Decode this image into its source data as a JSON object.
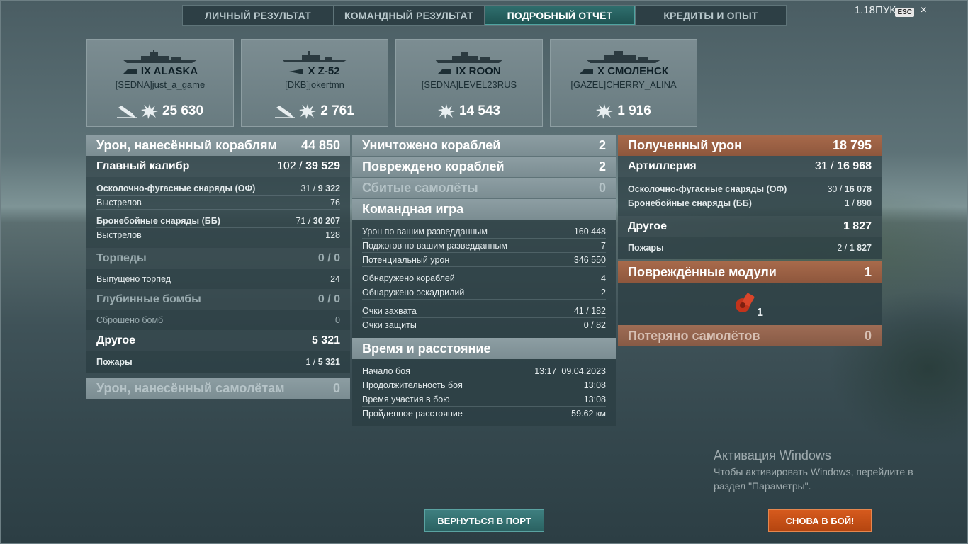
{
  "tabs": [
    "ЛИЧНЫЙ РЕЗУЛЬТАТ",
    "КОМАНДНЫЙ РЕЗУЛЬТАТ",
    "ПОДРОБНЫЙ ОТЧЁТ",
    "КРЕДИТЫ И ОПЫТ"
  ],
  "active_tab": 2,
  "top_right": {
    "label": "1.18ПУК",
    "esc": "ESC",
    "close": "×"
  },
  "ships": [
    {
      "tier": "IX",
      "name": "ALASKA",
      "player": "[SEDNA]just_a_game",
      "damage": "25 630",
      "has_sunk_icon": true
    },
    {
      "tier": "X",
      "name": "Z-52",
      "player": "[DKB]jokertmn",
      "damage": "2 761",
      "has_sunk_icon": true
    },
    {
      "tier": "IX",
      "name": "ROON",
      "player": "[SEDNA]LEVEL23RUS",
      "damage": "14 543",
      "has_sunk_icon": false
    },
    {
      "tier": "X",
      "name": "СМОЛЕНСК",
      "player": "[GAZEL]CHERRY_ALINA",
      "damage": "1 916",
      "has_sunk_icon": false
    }
  ],
  "left": {
    "header": {
      "label": "Урон, нанесённый кораблям",
      "value": "44 850"
    },
    "main_battery": {
      "label": "Главный калибр",
      "hits": "102",
      "value": "39 529"
    },
    "he": {
      "label": "Осколочно-фугасные снаряды (ОФ)",
      "hits": "31",
      "value": "9 322"
    },
    "he_shots": {
      "label": "Выстрелов",
      "value": "76"
    },
    "ap": {
      "label": "Бронебойные снаряды (ББ)",
      "hits": "71",
      "value": "30 207"
    },
    "ap_shots": {
      "label": "Выстрелов",
      "value": "128"
    },
    "torpedoes": {
      "label": "Торпеды",
      "value": "0 / 0"
    },
    "torpedoes_fired": {
      "label": "Выпущено торпед",
      "value": "24"
    },
    "depth_charges": {
      "label": "Глубинные бомбы",
      "value": "0 / 0"
    },
    "bombs_dropped": {
      "label": "Сброшено бомб",
      "value": "0"
    },
    "other": {
      "label": "Другое",
      "value": "5 321"
    },
    "fires": {
      "label": "Пожары",
      "hits": "1",
      "value": "5 321"
    },
    "aircraft_damage": {
      "label": "Урон, нанесённый самолётам",
      "value": "0"
    }
  },
  "middle": {
    "destroyed": {
      "label": "Уничтожено кораблей",
      "value": "2"
    },
    "damaged": {
      "label": "Повреждено кораблей",
      "value": "2"
    },
    "planes_shot": {
      "label": "Сбитые самолёты",
      "value": "0"
    },
    "team_play": {
      "title": "Командная игра",
      "rows": [
        {
          "label": "Урон по вашим разведданным",
          "value": "160 448"
        },
        {
          "label": "Поджогов по вашим разведданным",
          "value": "7"
        },
        {
          "label": "Потенциальный урон",
          "value": "346 550"
        },
        {
          "label": "Обнаружено кораблей",
          "value": "4"
        },
        {
          "label": "Обнаружено эскадрилий",
          "value": "2"
        },
        {
          "label": "Очки захвата",
          "value": "41 / 182"
        },
        {
          "label": "Очки защиты",
          "value": "0 / 82"
        }
      ]
    },
    "time": {
      "title": "Время и расстояние",
      "rows": [
        {
          "label": "Начало боя",
          "value": "13:17  09.04.2023"
        },
        {
          "label": "Продолжительность боя",
          "value": "13:08"
        },
        {
          "label": "Время участия в бою",
          "value": "13:08"
        },
        {
          "label": "Пройденное расстояние",
          "value": "59.62 км"
        }
      ]
    }
  },
  "right": {
    "received": {
      "label": "Полученный урон",
      "value": "18 795"
    },
    "artillery": {
      "label": "Артиллерия",
      "hits": "31",
      "value": "16 968"
    },
    "he": {
      "label": "Осколочно-фугасные снаряды (ОФ)",
      "hits": "30",
      "value": "16 078"
    },
    "ap": {
      "label": "Бронебойные снаряды (ББ)",
      "hits": "1",
      "value": "890"
    },
    "other": {
      "label": "Другое",
      "value": "1 827"
    },
    "fires": {
      "label": "Пожары",
      "hits": "2",
      "value": "1 827"
    },
    "modules": {
      "label": "Повреждённые модули",
      "value": "1",
      "icon_count": "1"
    },
    "planes_lost": {
      "label": "Потеряно самолётов",
      "value": "0"
    }
  },
  "buttons": {
    "port": "ВЕРНУТЬСЯ В ПОРТ",
    "battle": "СНОВА В БОЙ!"
  },
  "watermark": {
    "title": "Активация Windows",
    "line1": "Чтобы активировать Windows, перейдите в",
    "line2": "раздел \"Параметры\"."
  },
  "colors": {
    "accent_teal": "#2f6f6e",
    "accent_orange": "#d65a1d",
    "received_header": "#a86a4b"
  }
}
